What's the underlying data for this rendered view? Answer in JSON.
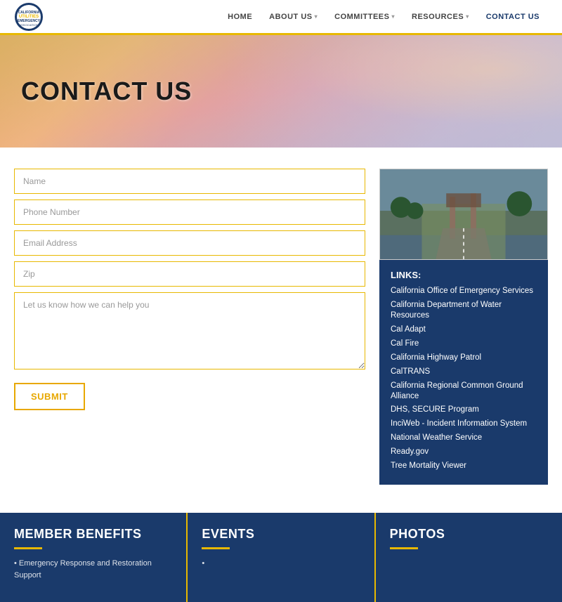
{
  "header": {
    "logo_text": "CALIFORNIA UTILITIES EMERGENCY ASSOCIATION",
    "nav": [
      {
        "label": "HOME",
        "has_dropdown": false
      },
      {
        "label": "ABOUT US",
        "has_dropdown": true
      },
      {
        "label": "COMMITTEES",
        "has_dropdown": true
      },
      {
        "label": "RESOURCES",
        "has_dropdown": true
      },
      {
        "label": "CONTACT US",
        "has_dropdown": false
      }
    ]
  },
  "hero": {
    "title": "CONTACT US"
  },
  "form": {
    "name_placeholder": "Name",
    "phone_placeholder": "Phone Number",
    "email_placeholder": "Email Address",
    "zip_placeholder": "Zip",
    "message_placeholder": "Let us know how we can help you",
    "submit_label": "SUBMIT"
  },
  "sidebar": {
    "links_title": "LINKS:",
    "links": [
      {
        "label": "California Office of Emergency Services",
        "url": "#"
      },
      {
        "label": "California Department of Water Resources",
        "url": "#"
      },
      {
        "label": "Cal Adapt",
        "url": "#"
      },
      {
        "label": "Cal Fire",
        "url": "#"
      },
      {
        "label": "California Highway Patrol",
        "url": "#"
      },
      {
        "label": "CalTRANS",
        "url": "#"
      },
      {
        "label": "California Regional Common Ground Alliance",
        "url": "#"
      },
      {
        "label": "DHS, SECURE Program",
        "url": "#"
      },
      {
        "label": "InciWeb - Incident Information System",
        "url": "#"
      },
      {
        "label": "National Weather Service",
        "url": "#"
      },
      {
        "label": "Ready.gov",
        "url": "#"
      },
      {
        "label": "Tree Mortality Viewer",
        "url": "#"
      }
    ]
  },
  "footer_cards": [
    {
      "title": "MEMBER BENEFITS",
      "subtext": "• Emergency Response and Restoration Support"
    },
    {
      "title": "EVENTS",
      "subtext": "•"
    },
    {
      "title": "PHOTOS",
      "subtext": ""
    }
  ]
}
